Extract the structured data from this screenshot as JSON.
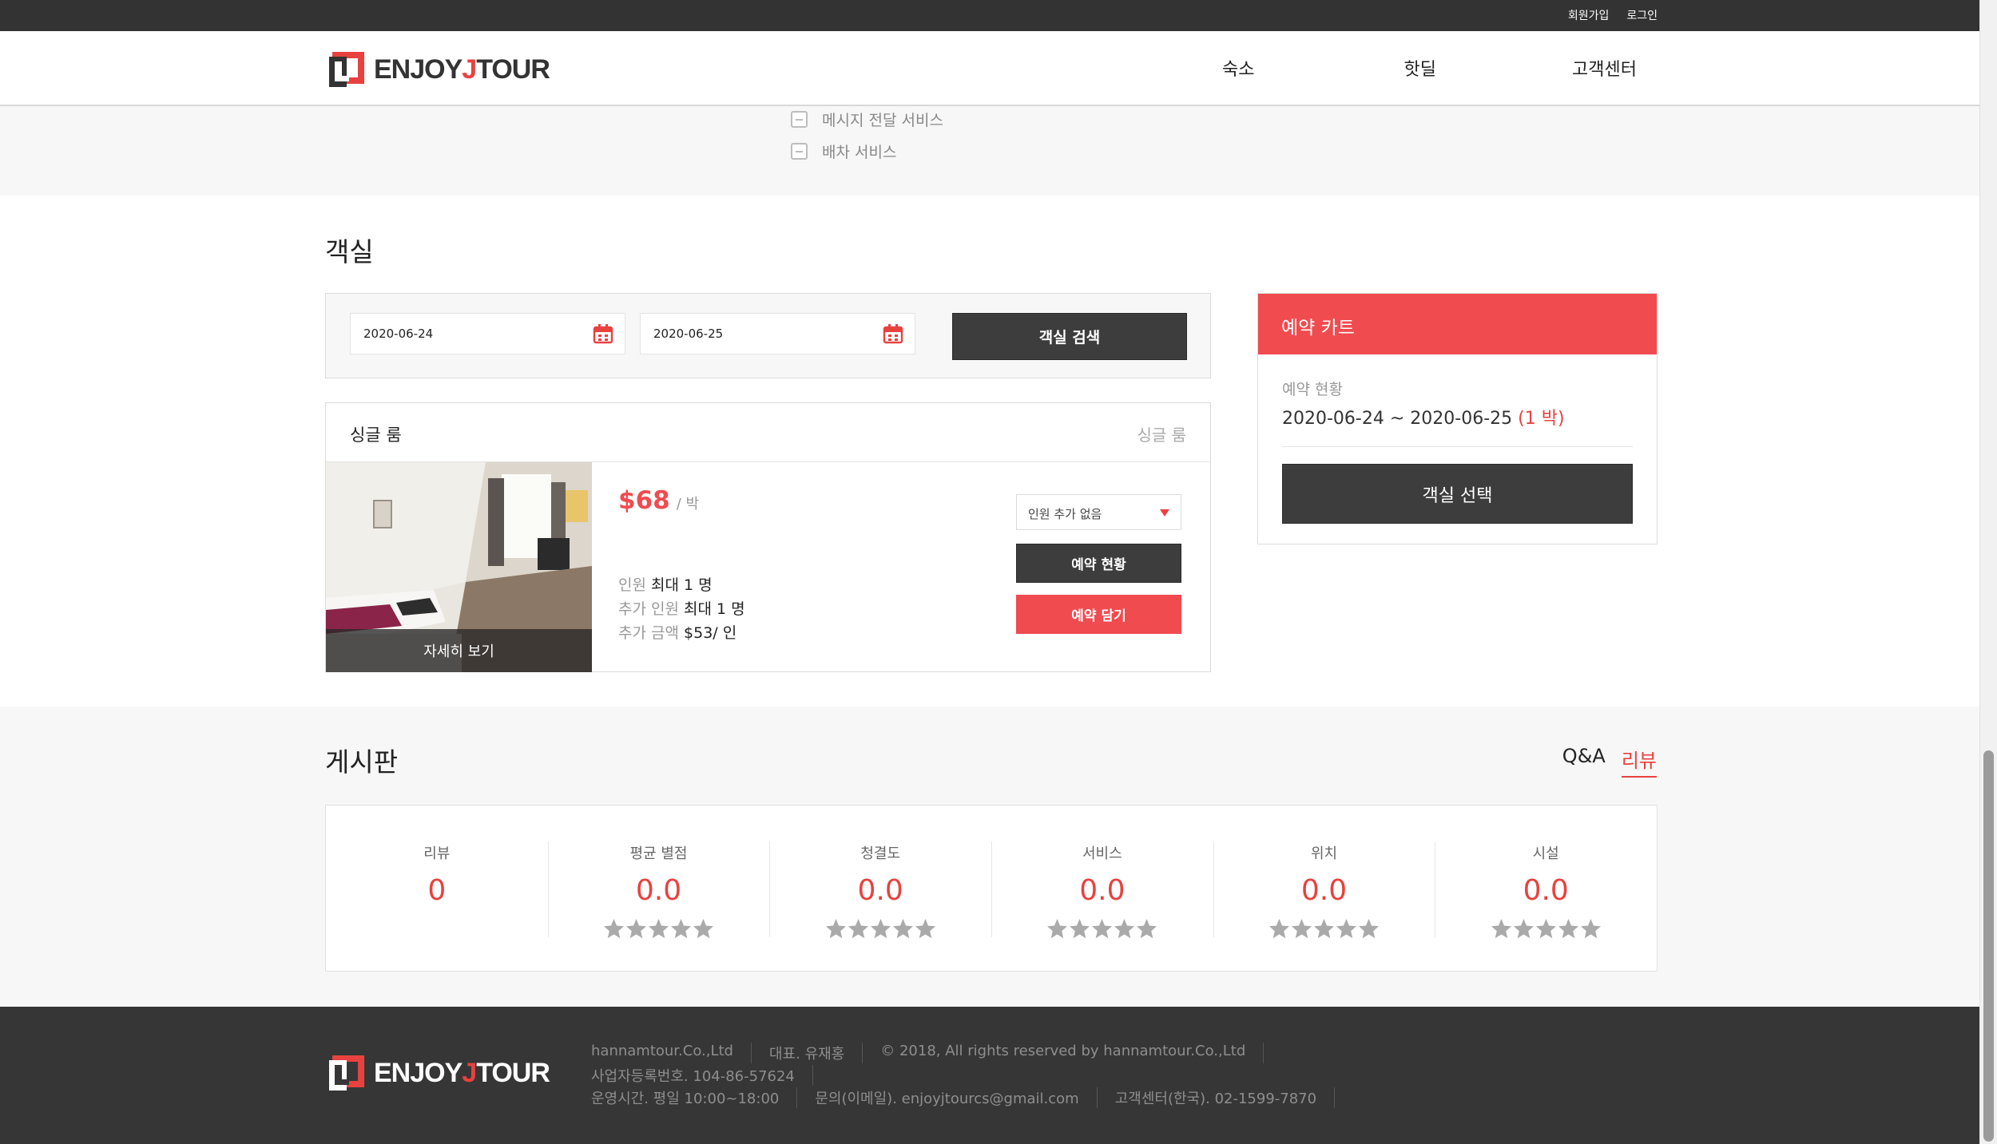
{
  "topbar": {
    "signup": "회원가입",
    "login": "로그인"
  },
  "header": {
    "logo": {
      "prefix": "ENJOY",
      "j": "J",
      "suffix": "TOUR"
    },
    "nav": [
      "숙소",
      "핫딜",
      "고객센터"
    ]
  },
  "services": {
    "items": [
      "메시지 전달 서비스",
      "배차 서비스"
    ]
  },
  "rooms": {
    "title": "객실",
    "search": {
      "checkin": "2020-06-24",
      "checkout": "2020-06-25",
      "button": "객실 검색"
    },
    "room": {
      "name": "싱글 룸",
      "type": "싱글 룸",
      "detail_label": "자세히 보기",
      "price": "$68",
      "price_unit": "/ 박",
      "specs": [
        {
          "label": "인원",
          "value": "최대 1 명"
        },
        {
          "label": "추가 인원",
          "value": "최대 1 명"
        },
        {
          "label": "추가 금액",
          "value": "$53/ 인"
        }
      ],
      "extra_select": "인원 추가 없음",
      "status_button": "예약 현황",
      "add_button": "예약 담기"
    }
  },
  "cart": {
    "title": "예약 카트",
    "status_label": "예약 현황",
    "dates": "2020-06-24 ~ 2020-06-25",
    "nights": "(1 박)",
    "select_button": "객실 선택"
  },
  "board": {
    "title": "게시판",
    "tabs": [
      {
        "label": "Q&A",
        "active": false
      },
      {
        "label": "리뷰",
        "active": true
      }
    ],
    "stats": [
      {
        "label": "리뷰",
        "value": "0",
        "stars": null
      },
      {
        "label": "평균 별점",
        "value": "0.0",
        "stars": 0
      },
      {
        "label": "청결도",
        "value": "0.0",
        "stars": 0
      },
      {
        "label": "서비스",
        "value": "0.0",
        "stars": 0
      },
      {
        "label": "위치",
        "value": "0.0",
        "stars": 0
      },
      {
        "label": "시설",
        "value": "0.0",
        "stars": 0
      }
    ]
  },
  "footer": {
    "line1": [
      "hannamtour.Co.,Ltd",
      "대표. 유재홍",
      "© 2018, All rights reserved by hannamtour.Co.,Ltd"
    ],
    "line2": [
      "사업자등록번호. 104-86-57624"
    ],
    "line3": [
      "운영시간. 평일 10:00~18:00",
      "문의(이메일). enjoyjtourcs@gmail.com",
      "고객센터(한국). 02-1599-7870"
    ]
  },
  "colors": {
    "accent": "#f04b4f",
    "dark": "#3d3d3d",
    "topbar": "#333333",
    "footer": "#363636"
  }
}
